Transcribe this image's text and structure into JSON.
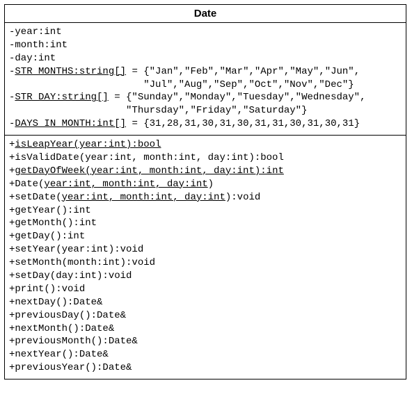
{
  "class_name": "Date",
  "attributes": {
    "year": "-year:int",
    "month": "-month:int",
    "day": "-day:int",
    "str_months_p": "-",
    "str_months_u": "STR MONTHS:string[]",
    "str_months_v1": " = {\"Jan\",\"Feb\",\"Mar\",\"Apr\",\"May\",\"Jun\",",
    "str_months_v2": "                       \"Jul\",\"Aug\",\"Sep\",\"Oct\",\"Nov\",\"Dec\"}",
    "str_day_p": "-",
    "str_day_u": "STR DAY:string[]",
    "str_day_v1": " = {\"Sunday\",\"Monday\",\"Tuesday\",\"Wednesday\",",
    "str_day_v2": "                    \"Thursday\",\"Friday\",\"Saturday\"}",
    "days_in_month_p": "-",
    "days_in_month_u": "DAYS IN MONTH:int[]",
    "days_in_month_v": " = {31,28,31,30,31,30,31,31,30,31,30,31}"
  },
  "methods": {
    "isLeapYear_p": "+",
    "isLeapYear_u": "isLeapYear(year:int):bool",
    "isValidDate": "+isValidDate(year:int, month:int, day:int):bool",
    "getDayOfWeek_p": "+",
    "getDayOfWeek_u": "getDayOfWeek(year:int, month:int, day:int):int",
    "ctor_a": "+Date(",
    "ctor_u": "year:int, month:int, day:int",
    "ctor_b": ")",
    "setDate_a": "+setDate(",
    "setDate_u": "year:int, month:int, day:int",
    "setDate_b": "):void",
    "getYear": "+getYear():int",
    "getMonth": "+getMonth():int",
    "getDay": "+getDay():int",
    "setYear": "+setYear(year:int):void",
    "setMonth": "+setMonth(month:int):void",
    "setDay": "+setDay(day:int):void",
    "print": "+print():void",
    "nextDay": "+nextDay():Date&",
    "previousDay": "+previousDay():Date&",
    "nextMonth": "+nextMonth():Date&",
    "previousMonth": "+previousMonth():Date&",
    "nextYear": "+nextYear():Date&",
    "previousYear": "+previousYear():Date&"
  }
}
